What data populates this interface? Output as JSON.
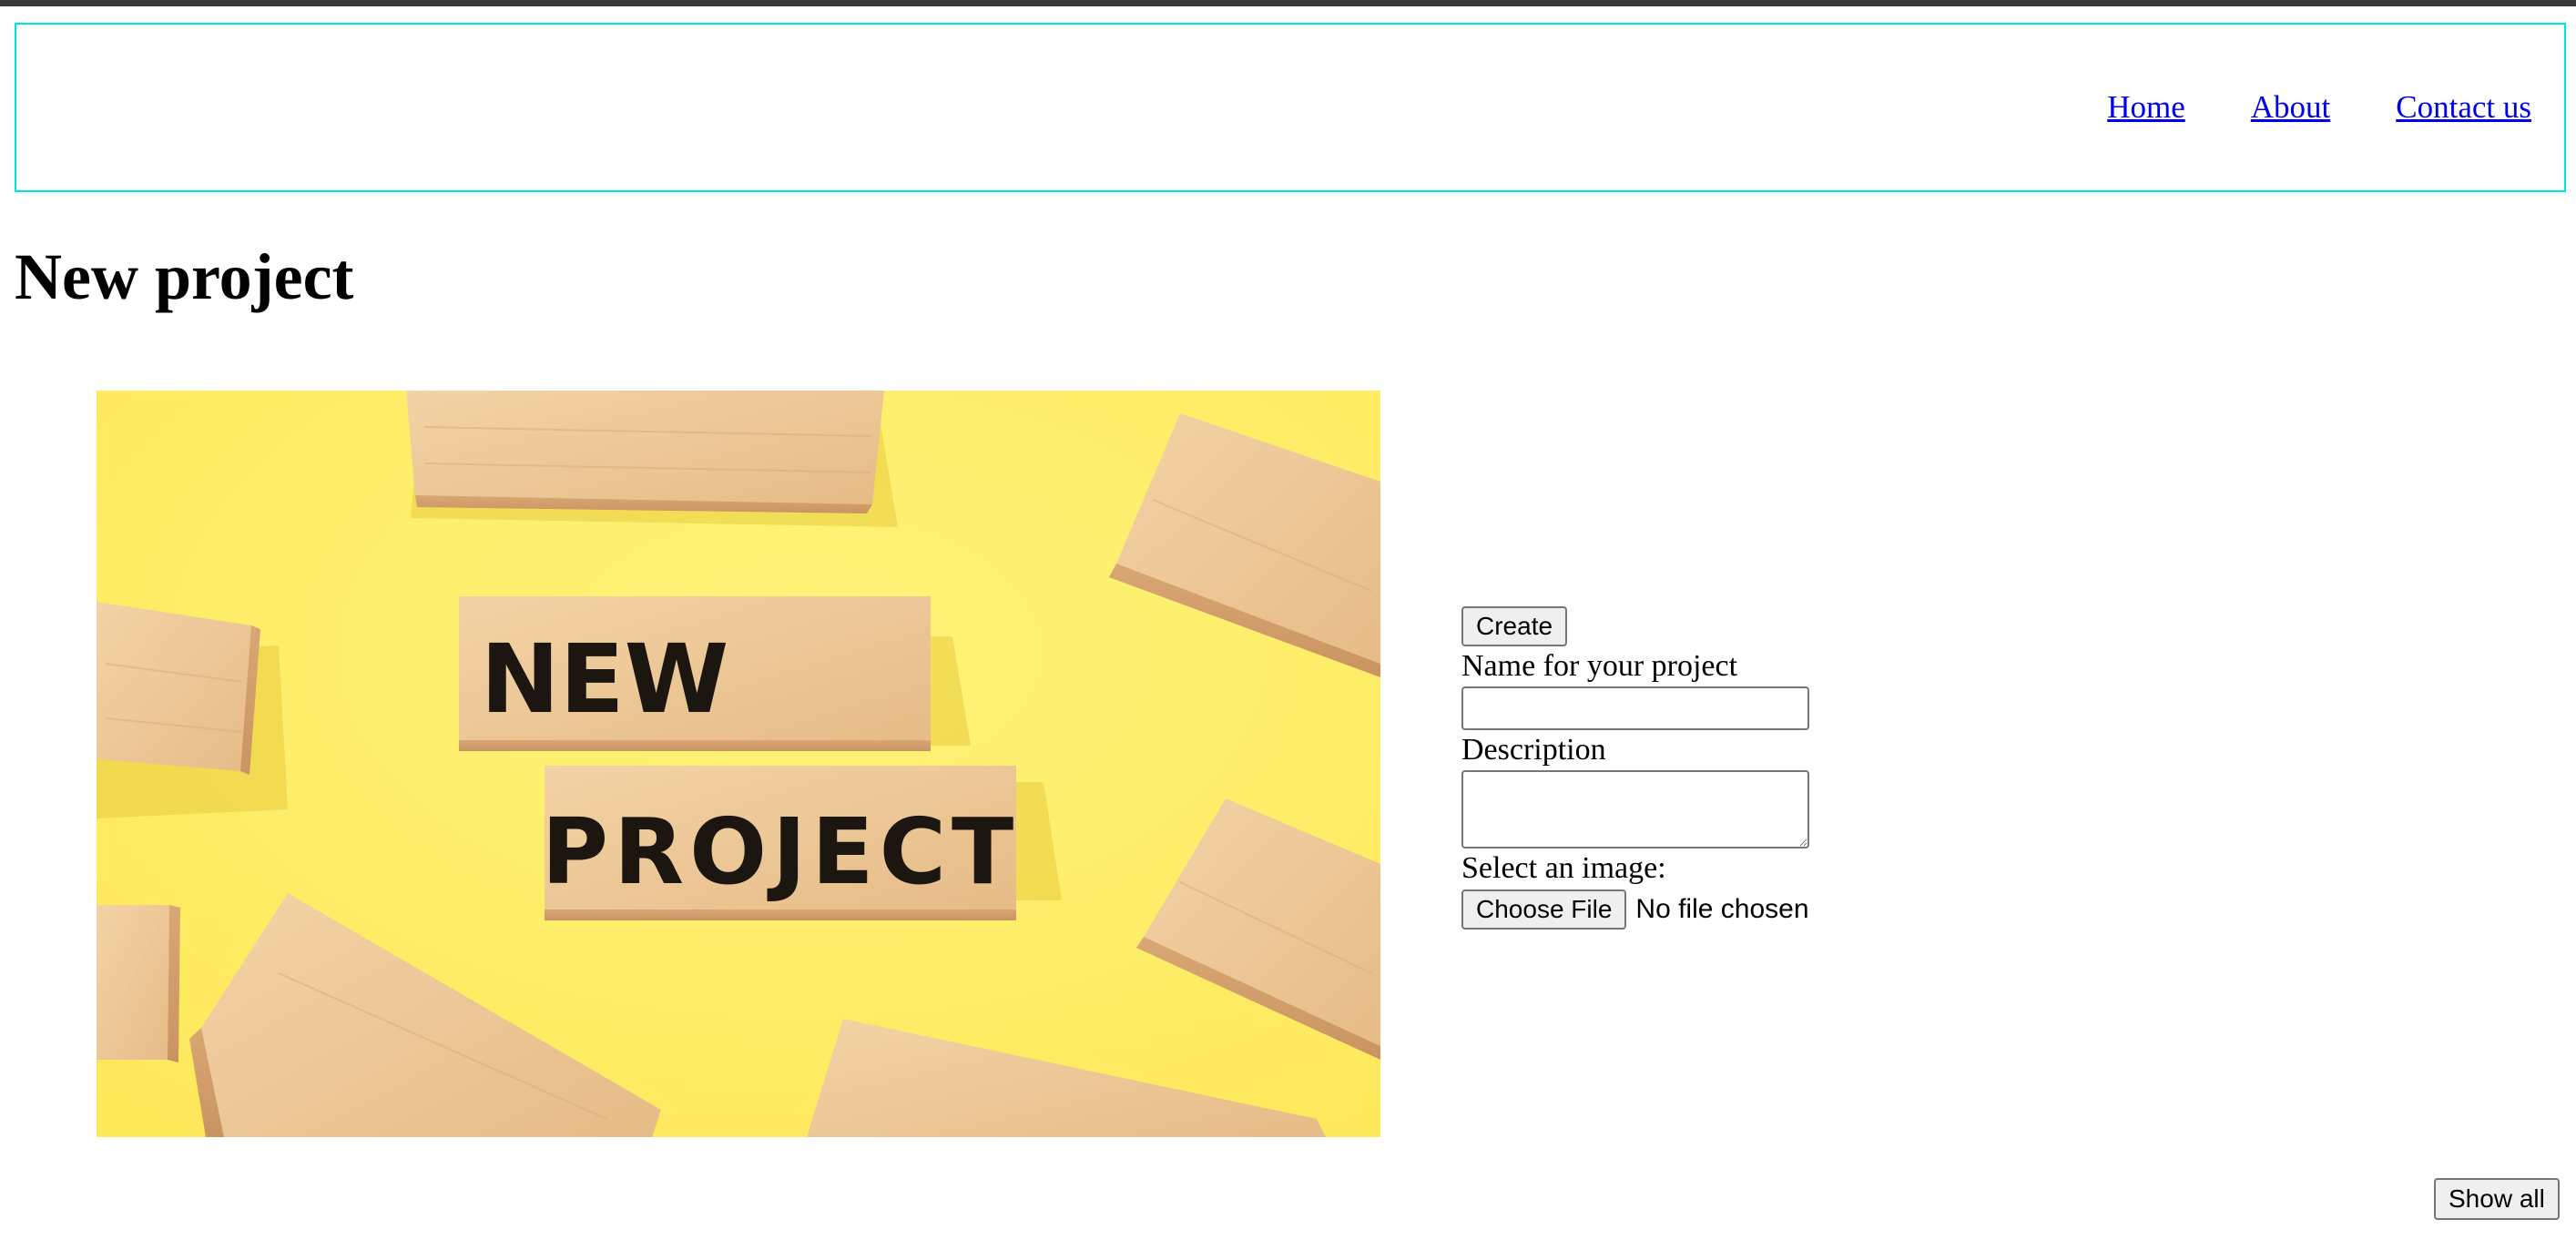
{
  "header": {
    "nav": [
      {
        "label": "Home"
      },
      {
        "label": "About"
      },
      {
        "label": "Contact us"
      }
    ]
  },
  "page": {
    "title": "New project"
  },
  "hero_image": {
    "text_line1": "NEW",
    "text_line2": "PROJECT"
  },
  "form": {
    "create_label": "Create",
    "name_label": "Name for your project",
    "name_value": "",
    "description_label": "Description",
    "description_value": "",
    "image_label": "Select an image:",
    "file_button_label": "Choose File",
    "file_status": "No file chosen"
  },
  "footer": {
    "show_all_label": "Show all"
  },
  "colors": {
    "header_border": "#00e5e5",
    "link": "#0000ee",
    "hero_background": "#fdf06a"
  }
}
